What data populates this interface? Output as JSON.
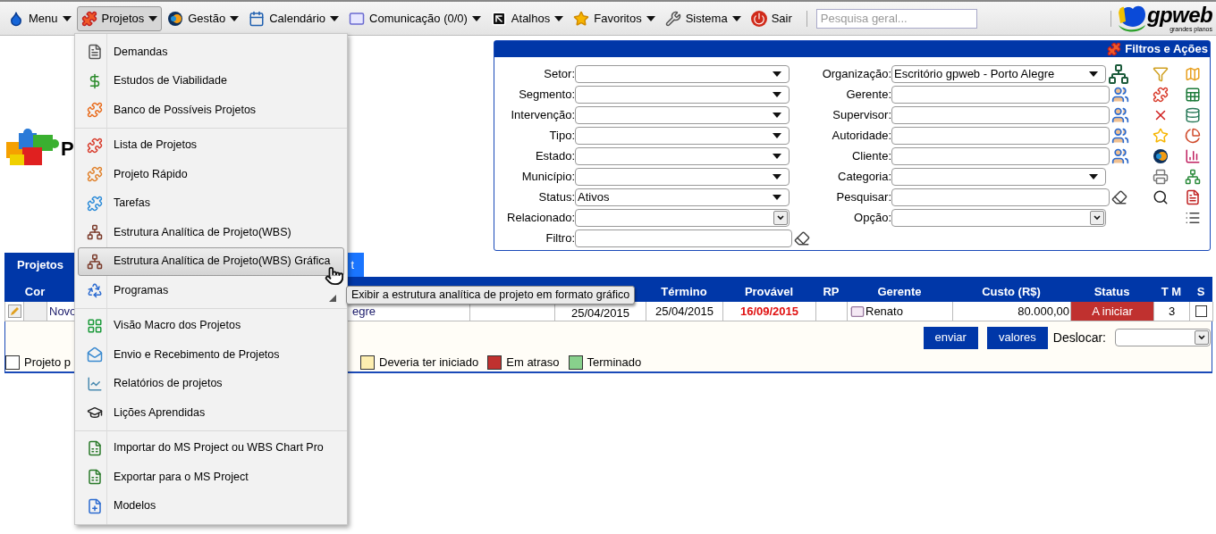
{
  "top_menu": {
    "items": [
      {
        "label": "Menu",
        "selected": false,
        "has_dropdown": true
      },
      {
        "label": "Projetos",
        "selected": true,
        "has_dropdown": true
      },
      {
        "label": "Gestão",
        "selected": false,
        "has_dropdown": true
      },
      {
        "label": "Calendário",
        "selected": false,
        "has_dropdown": true
      },
      {
        "label": "Comunicação (0/0)",
        "selected": false,
        "has_dropdown": true
      },
      {
        "label": "Atalhos",
        "selected": false,
        "has_dropdown": true
      },
      {
        "label": "Favoritos",
        "selected": false,
        "has_dropdown": true
      },
      {
        "label": "Sistema",
        "selected": false,
        "has_dropdown": true
      },
      {
        "label": "Sair",
        "selected": false,
        "has_dropdown": false
      }
    ],
    "search": {
      "placeholder": "Pesquisa geral..."
    },
    "logo": {
      "name": "gpweb",
      "tagline": "grandes planos"
    }
  },
  "page_title": "P",
  "filters": {
    "title": "Filtros e Ações",
    "left_fields": [
      {
        "label": "Setor:",
        "kind": "select"
      },
      {
        "label": "Segmento:",
        "kind": "select"
      },
      {
        "label": "Intervenção:",
        "kind": "select"
      },
      {
        "label": "Tipo:",
        "kind": "select"
      },
      {
        "label": "Estado:",
        "kind": "select"
      },
      {
        "label": "Município:",
        "kind": "select"
      },
      {
        "label": "Status:",
        "kind": "select",
        "value": "Ativos"
      },
      {
        "label": "Relacionado:",
        "kind": "combo"
      },
      {
        "label": "Filtro:",
        "kind": "text"
      }
    ],
    "right_fields": [
      {
        "label": "Organização:",
        "kind": "select",
        "value": "Escritório gpweb - Porto Alegre"
      },
      {
        "label": "Gerente:",
        "kind": "text"
      },
      {
        "label": "Supervisor:",
        "kind": "text"
      },
      {
        "label": "Autoridade:",
        "kind": "text"
      },
      {
        "label": "Cliente:",
        "kind": "text"
      },
      {
        "label": "Categoria:",
        "kind": "select"
      },
      {
        "label": "Pesquisar:",
        "kind": "text"
      },
      {
        "label": "Opção:",
        "kind": "combo"
      }
    ]
  },
  "tabs": [
    {
      "label": "Projetos",
      "selected": true
    },
    {
      "label": "t",
      "selected": false
    }
  ],
  "table": {
    "columns": [
      {
        "label": "Cor"
      },
      {
        "label": "Término"
      },
      {
        "label": "Provável"
      },
      {
        "label": "RP"
      },
      {
        "label": "Gerente"
      },
      {
        "label": "Custo (R$)"
      },
      {
        "label": "Status"
      },
      {
        "label": "T M"
      },
      {
        "label": "S"
      }
    ],
    "rows": [
      {
        "name": "Novo",
        "organization": "egre",
        "start": "25/04/2015",
        "end": "25/04/2015",
        "probable": "16/09/2015",
        "probable_late": true,
        "manager": "Renato",
        "cost": "80.000,00",
        "status": "A iniciar",
        "color": "#c0312f",
        "tm": "3",
        "checked": false
      }
    ]
  },
  "actions": {
    "buttons": [
      "enviar",
      "valores"
    ],
    "shift_label": "Deslocar:"
  },
  "legend": [
    {
      "label": "Projeto p",
      "color": "#ffffff"
    },
    {
      "label": "Deveria ter iniciado",
      "color": "#fdeeb0"
    },
    {
      "label": "Em atraso",
      "color": "#c0312f"
    },
    {
      "label": "Terminado",
      "color": "#88d08c"
    }
  ],
  "dropdown_menu": {
    "groups": [
      [
        {
          "label": "Demandas",
          "selected": false
        },
        {
          "label": "Estudos de Viabilidade",
          "selected": false
        },
        {
          "label": "Banco de Possíveis Projetos",
          "selected": false
        }
      ],
      [
        {
          "label": "Lista de Projetos",
          "selected": false
        },
        {
          "label": "Projeto Rápido",
          "selected": false
        },
        {
          "label": "Tarefas",
          "selected": false
        },
        {
          "label": "Estrutura Analítica de Projeto(WBS)",
          "selected": false
        },
        {
          "label": "Estrutura Analítica de Projeto(WBS) Gráfica",
          "selected": true
        },
        {
          "label": "Programas",
          "selected": false,
          "has_submenu": true
        }
      ],
      [
        {
          "label": "Visão Macro dos Projetos",
          "selected": false
        },
        {
          "label": "Envio e Recebimento de Projetos",
          "selected": false
        },
        {
          "label": "Relatórios de projetos",
          "selected": false
        },
        {
          "label": "Lições Aprendidas",
          "selected": false
        }
      ],
      [
        {
          "label": "Importar do MS Project ou WBS Chart Pro",
          "selected": false
        },
        {
          "label": "Exportar para o MS Project",
          "selected": false
        },
        {
          "label": "Modelos",
          "selected": false
        }
      ]
    ]
  },
  "tooltip": "Exibir a estrutura analítica de projeto em formato gráfico"
}
